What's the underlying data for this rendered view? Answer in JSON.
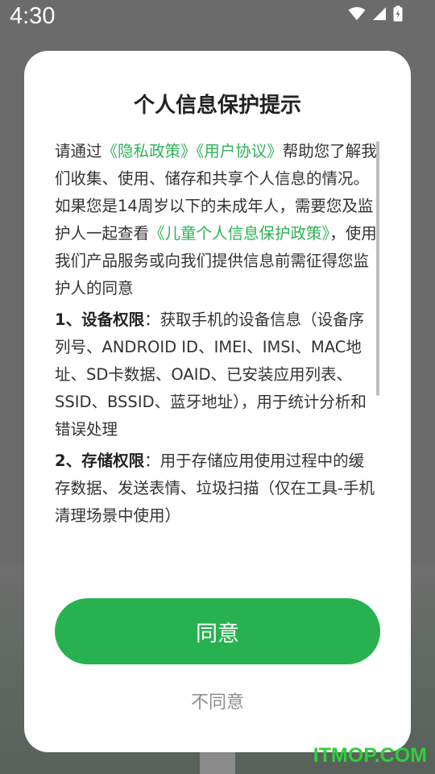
{
  "status_bar": {
    "time": "4:30",
    "icons": [
      "wifi-icon",
      "cell-signal-icon",
      "battery-charging-icon"
    ]
  },
  "dialog": {
    "title": "个人信息保护提示",
    "intro_prefix": "请通过",
    "privacy_policy_link": "《隐私政策》",
    "user_agreement_link": "《用户协议》",
    "intro_suffix": "帮助您了解我们收集、使用、储存和共享个人信息的情况。",
    "minor_prefix": "如果您是14周岁以下的未成年人，需要您及监护人一起查看",
    "child_policy_link": "《儿童个人信息保护政策》",
    "minor_suffix": "，使用我们产品服务或向我们提供信息前需征得您监护人的同意",
    "perm1_title": "1、设备权限",
    "perm1_text": "：获取手机的设备信息（设备序列号、ANDROID ID、IMEI、IMSI、MAC地址、SD卡数据、OAID、已安装应用列表、SSID、BSSID、蓝牙地址），用于统计分析和错误处理",
    "perm2_title": "2、存储权限",
    "perm2_text": "：用于存储应用使用过程中的缓存数据、发送表情、垃圾扫描（仅在工具-手机清理场景中使用）",
    "agree_label": "同意",
    "disagree_label": "不同意"
  },
  "watermark": "ITMOP.COM",
  "colors": {
    "accent": "#27b24f",
    "link": "#2eb257",
    "overlay": "#6b6b6b"
  }
}
